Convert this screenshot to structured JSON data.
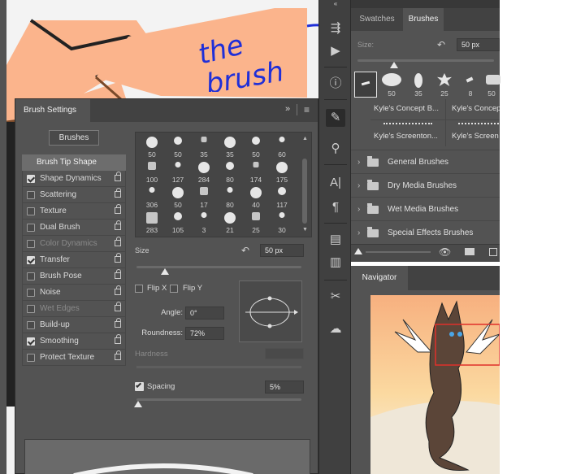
{
  "annotation": {
    "text_line1": "the",
    "text_line2": "brush",
    "color": "#1f2fd8"
  },
  "brushes_panel": {
    "tabs": [
      "Swatches",
      "Brushes"
    ],
    "size_label": "Size:",
    "size_value": "50 px",
    "size_fraction": 0.27,
    "thumb_numbers": [
      "50",
      "35",
      "25",
      "8",
      "50"
    ],
    "named_brushes": [
      "Kyle's Concept B...",
      "Kyle's Concep",
      "Kyle's Screenton...",
      "Kyle's Screen"
    ],
    "folders": [
      "General Brushes",
      "Dry Media Brushes",
      "Wet Media Brushes",
      "Special Effects Brushes"
    ]
  },
  "navigator": {
    "tab": "Navigator"
  },
  "brush_settings": {
    "title": "Brush Settings",
    "brushes_button": "Brushes",
    "brush_tip_shape": "Brush Tip Shape",
    "items": [
      {
        "label": "Shape Dynamics",
        "checked": true,
        "disabled": false
      },
      {
        "label": "Scattering",
        "checked": false,
        "disabled": false
      },
      {
        "label": "Texture",
        "checked": false,
        "disabled": false
      },
      {
        "label": "Dual Brush",
        "checked": false,
        "disabled": false
      },
      {
        "label": "Color Dynamics",
        "checked": false,
        "disabled": true
      },
      {
        "label": "Transfer",
        "checked": true,
        "disabled": false
      },
      {
        "label": "Brush Pose",
        "checked": false,
        "disabled": false
      },
      {
        "label": "Noise",
        "checked": false,
        "disabled": false
      },
      {
        "label": "Wet Edges",
        "checked": false,
        "disabled": true
      },
      {
        "label": "Build-up",
        "checked": false,
        "disabled": false
      },
      {
        "label": "Smoothing",
        "checked": true,
        "disabled": false
      },
      {
        "label": "Protect Texture",
        "checked": false,
        "disabled": false
      }
    ],
    "tip_grid_numbers": [
      [
        "50",
        "50",
        "35",
        "35",
        "50",
        "60"
      ],
      [
        "100",
        "127",
        "284",
        "80",
        "174",
        "175"
      ],
      [
        "306",
        "50",
        "17",
        "80",
        "40",
        "117"
      ],
      [
        "283",
        "105",
        "3",
        "21",
        "25",
        "30"
      ]
    ],
    "size_label": "Size",
    "size_value": "50 px",
    "size_fraction": 0.17,
    "flip_x": "Flip X",
    "flip_y": "Flip Y",
    "angle_label": "Angle:",
    "angle_value": "0°",
    "roundness_label": "Roundness:",
    "roundness_value": "72%",
    "hardness_label": "Hardness",
    "spacing_label": "Spacing",
    "spacing_value": "5%",
    "spacing_fraction": 0.01
  }
}
